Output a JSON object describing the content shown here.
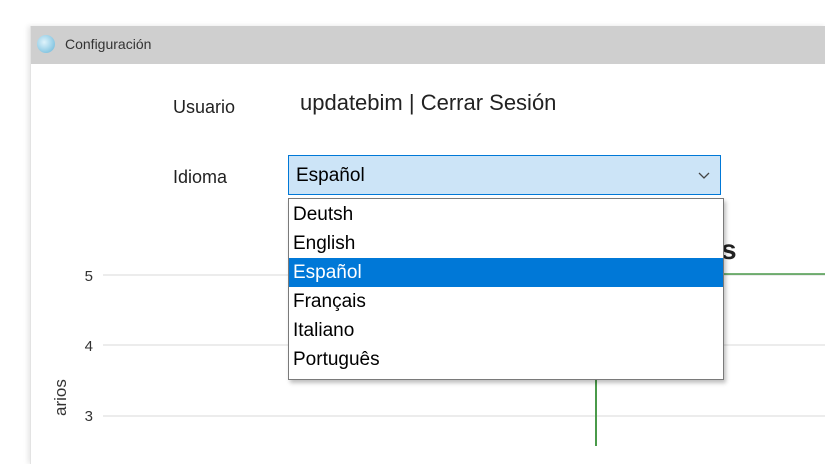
{
  "window": {
    "title": "Configuración",
    "icon": "app-globe-icon"
  },
  "form": {
    "user_label": "Usuario",
    "user_name": "updatebim",
    "user_separator": " | ",
    "logout_link": "Cerrar Sesión",
    "language_label": "Idioma",
    "language_selected": "Español",
    "language_options": [
      "Deutsh",
      "English",
      "Español",
      "Français",
      "Italiano",
      "Português"
    ]
  },
  "chart_data": {
    "type": "line",
    "title_fragment": "s",
    "ylabel_fragment": "arios",
    "y_tick_labels": [
      "5",
      "4",
      "3"
    ],
    "grid": true,
    "series_color": "#4a9a4a"
  },
  "colors": {
    "titlebar": "#cfcfcf",
    "accent": "#0078d7",
    "combo_background": "#cce4f7",
    "chart_line": "#4a9a4a"
  }
}
